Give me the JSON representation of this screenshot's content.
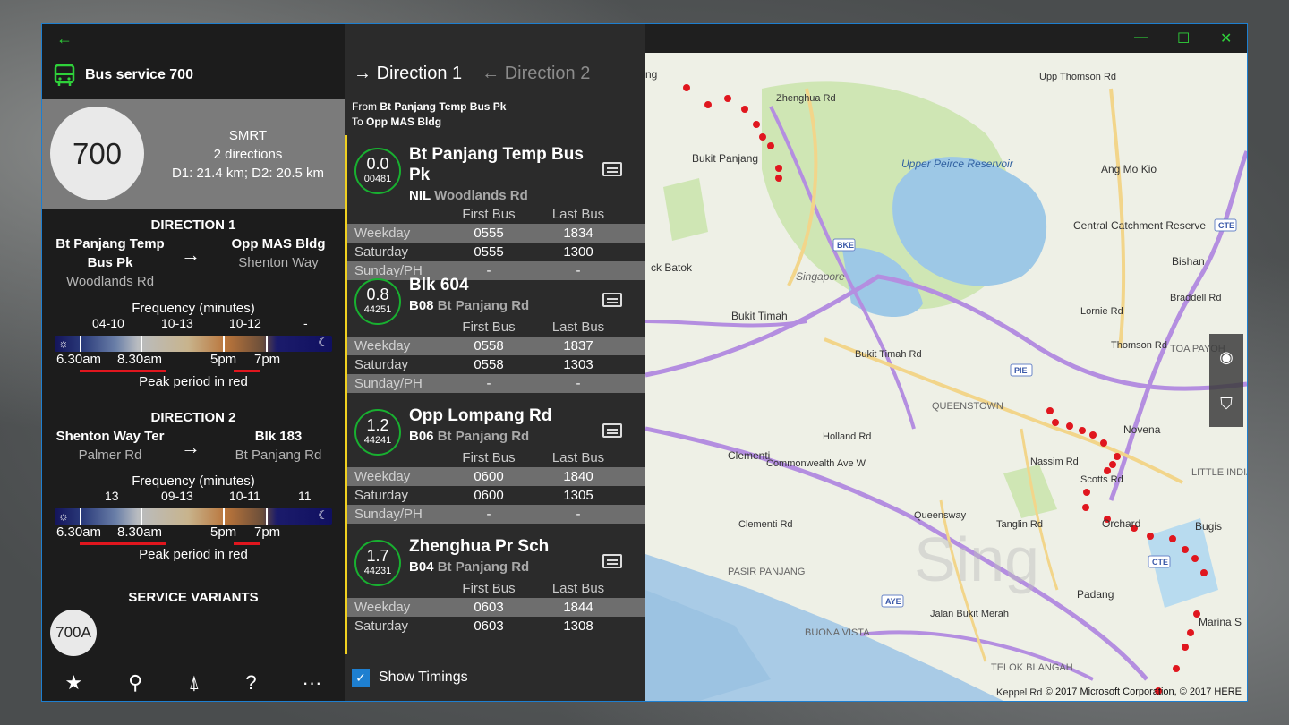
{
  "header": {
    "title": "Bus service 700"
  },
  "summary": {
    "service": "700",
    "operator": "SMRT",
    "directions": "2 directions",
    "distance": "D1: 21.4 km; D2: 20.5 km"
  },
  "direction1": {
    "title": "DIRECTION 1",
    "from_line1": "Bt Panjang Temp",
    "from_line2": "Bus Pk",
    "from_road": "Woodlands Rd",
    "to_name": "Opp MAS Bldg",
    "to_road": "Shenton Way",
    "freq_title": "Frequency (minutes)",
    "freq": [
      "04-10",
      "10-13",
      "10-12",
      "-"
    ],
    "times": [
      "6.30am",
      "8.30am",
      "5pm",
      "7pm"
    ],
    "peak": "Peak period in red"
  },
  "direction2": {
    "title": "DIRECTION 2",
    "from_name": "Shenton Way Ter",
    "from_road": "Palmer Rd",
    "to_name": "Blk 183",
    "to_road": "Bt Panjang Rd",
    "freq_title": "Frequency (minutes)",
    "freq": [
      "13",
      "09-13",
      "10-11",
      "11"
    ],
    "times": [
      "6.30am",
      "8.30am",
      "5pm",
      "7pm"
    ],
    "peak": "Peak period in red"
  },
  "variants": {
    "title": "SERVICE VARIANTS",
    "items": [
      "700A"
    ]
  },
  "appbar": {
    "fav": "★",
    "pin": "⚲",
    "nav": "⍋",
    "help": "?",
    "more": "···"
  },
  "mid": {
    "tab1": "Direction 1",
    "tab2": "Direction 2",
    "from_label": "From",
    "from": "Bt Panjang Temp Bus Pk",
    "to_label": "To",
    "to": "Opp MAS Bldg",
    "col_first": "First Bus",
    "col_last": "Last Bus",
    "row_weekday": "Weekday",
    "row_saturday": "Saturday",
    "row_sunday": "Sunday/PH",
    "show_timings": "Show Timings"
  },
  "stops": [
    {
      "dist": "0.0",
      "code": "00481",
      "name": "Bt Panjang Temp Bus Pk",
      "road_code": "NIL",
      "road": "Woodlands Rd",
      "weekday": [
        "0555",
        "1834"
      ],
      "saturday": [
        "0555",
        "1300"
      ],
      "sunday": [
        "-",
        "-"
      ]
    },
    {
      "dist": "0.8",
      "code": "44251",
      "name": "Blk 604",
      "road_code": "B08",
      "road": "Bt Panjang Rd",
      "weekday": [
        "0558",
        "1837"
      ],
      "saturday": [
        "0558",
        "1303"
      ],
      "sunday": [
        "-",
        "-"
      ]
    },
    {
      "dist": "1.2",
      "code": "44241",
      "name": "Opp Lompang Rd",
      "road_code": "B06",
      "road": "Bt Panjang Rd",
      "weekday": [
        "0600",
        "1840"
      ],
      "saturday": [
        "0600",
        "1305"
      ],
      "sunday": [
        "-",
        "-"
      ]
    },
    {
      "dist": "1.7",
      "code": "44231",
      "name": "Zhenghua Pr Sch",
      "road_code": "B04",
      "road": "Bt Panjang Rd",
      "weekday": [
        "0603",
        "1844"
      ],
      "saturday": [
        "0603",
        "1308"
      ],
      "sunday": [
        "-",
        "-"
      ]
    }
  ],
  "map": {
    "labels": [
      "Bukit Panjang",
      "Upper Peirce Reservoir",
      "Ang Mo Kio",
      "Central Catchment Reserve",
      "Bishan",
      "Braddell Rd",
      "Lornie Rd",
      "Singapore",
      "Bukit Timah",
      "Bukit Timah Rd",
      "TOA PAYOH",
      "QUEENSTOWN",
      "Novena",
      "Clementi",
      "LITTLE INDIA",
      "Bugis",
      "Orchard",
      "Padang",
      "PASIR PANJANG",
      "Jalan Bukit Merah",
      "BUONA VISTA",
      "Marina S",
      "TELOK BLANGAH",
      "Commonwealth Ave W",
      "Holland Rd",
      "Queensway",
      "Tanglin Rd",
      "Nassim Rd",
      "Scotts Rd",
      "Thomson Rd",
      "Upp Thomson Rd",
      "Zhenghua Rd",
      "Clementi Rd",
      "Keppel Rd",
      "ck Batok",
      "ng"
    ],
    "road_badges": [
      "BKE",
      "CTE",
      "PIE",
      "AYE",
      "AYE",
      "CTE"
    ],
    "copyright": "© 2017 Microsoft Corporation, © 2017 HERE",
    "watermark": "Sing"
  },
  "window": {
    "minimize": "—",
    "maximize": "☐",
    "close": "✕",
    "back": "←"
  }
}
